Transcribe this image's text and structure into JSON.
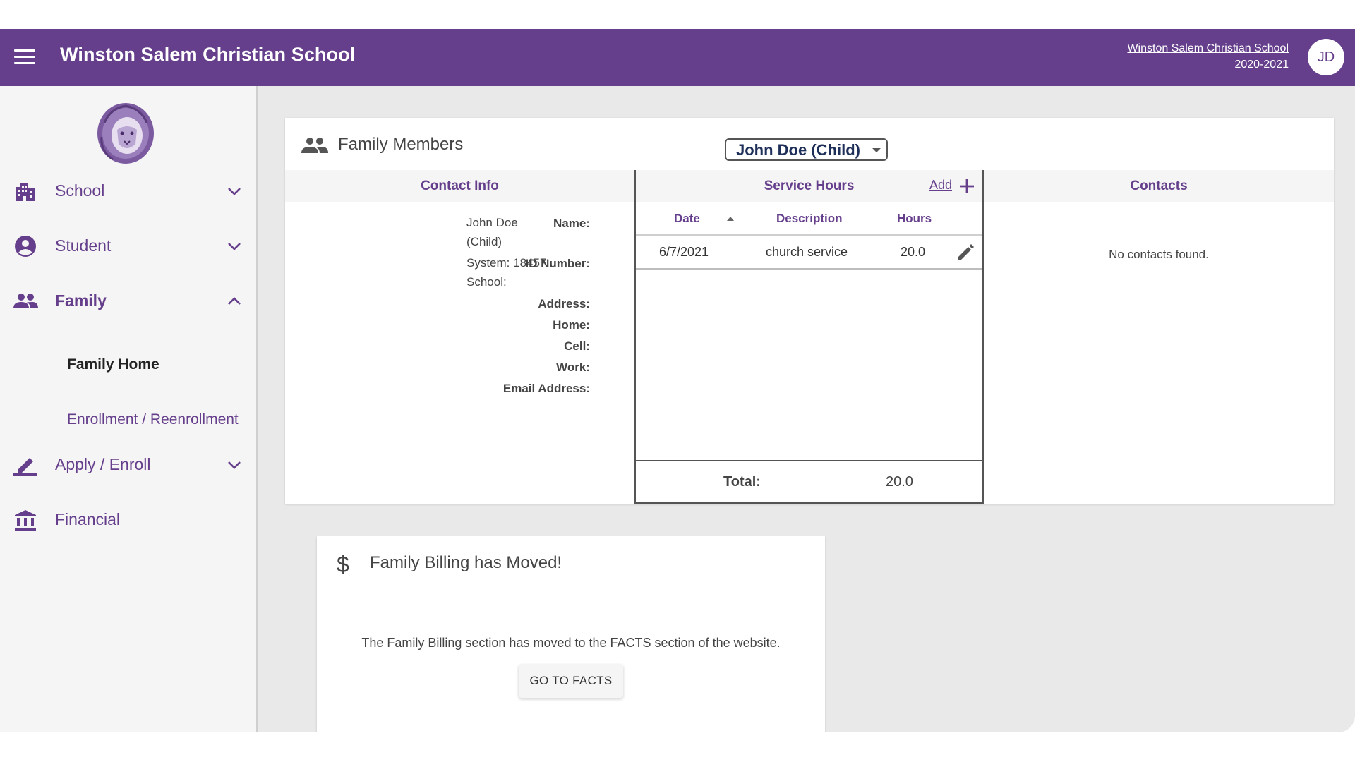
{
  "header": {
    "title": "Winston Salem Christian School",
    "school_link": "Winston Salem Christian School",
    "school_year": "2020-2021",
    "avatar_initials": "JD"
  },
  "sidebar": {
    "items": [
      {
        "label": "School",
        "icon": "building-icon",
        "expanded": false
      },
      {
        "label": "Student",
        "icon": "account-circle-icon",
        "expanded": false
      },
      {
        "label": "Family",
        "icon": "people-icon",
        "expanded": true
      },
      {
        "label": "Apply / Enroll",
        "icon": "edit-pen-icon",
        "expanded": false
      },
      {
        "label": "Financial",
        "icon": "bank-icon",
        "expanded": false
      }
    ],
    "family_sub": [
      {
        "label": "Family Home",
        "active": true
      },
      {
        "label": "Enrollment / Reenrollment",
        "active": false
      }
    ]
  },
  "family_members": {
    "title": "Family Members",
    "selected_member": "John Doe (Child)",
    "contact_info": {
      "header": "Contact Info",
      "name_label": "Name:",
      "name_value": "John Doe (Child)",
      "id_label": "ID Number:",
      "id_system": "System: 18457",
      "id_school": "School:",
      "address_label": "Address:",
      "home_label": "Home:",
      "cell_label": "Cell:",
      "work_label": "Work:",
      "email_label": "Email Address:"
    },
    "service_hours": {
      "header": "Service Hours",
      "add_label": "Add",
      "columns": [
        "Date",
        "Description",
        "Hours"
      ],
      "rows": [
        {
          "date": "6/7/2021",
          "description": "church service",
          "hours": "20.0"
        }
      ],
      "total_label": "Total:",
      "total_value": "20.0"
    },
    "contacts": {
      "header": "Contacts",
      "empty_text": "No contacts found."
    }
  },
  "billing": {
    "icon": "$",
    "title": "Family Billing has Moved!",
    "message": "The Family Billing section has moved to the FACTS section of the website.",
    "button_label": "GO TO FACTS"
  },
  "colors": {
    "brand_purple": "#663f8c",
    "panel_bg": "#e9e9e9"
  }
}
